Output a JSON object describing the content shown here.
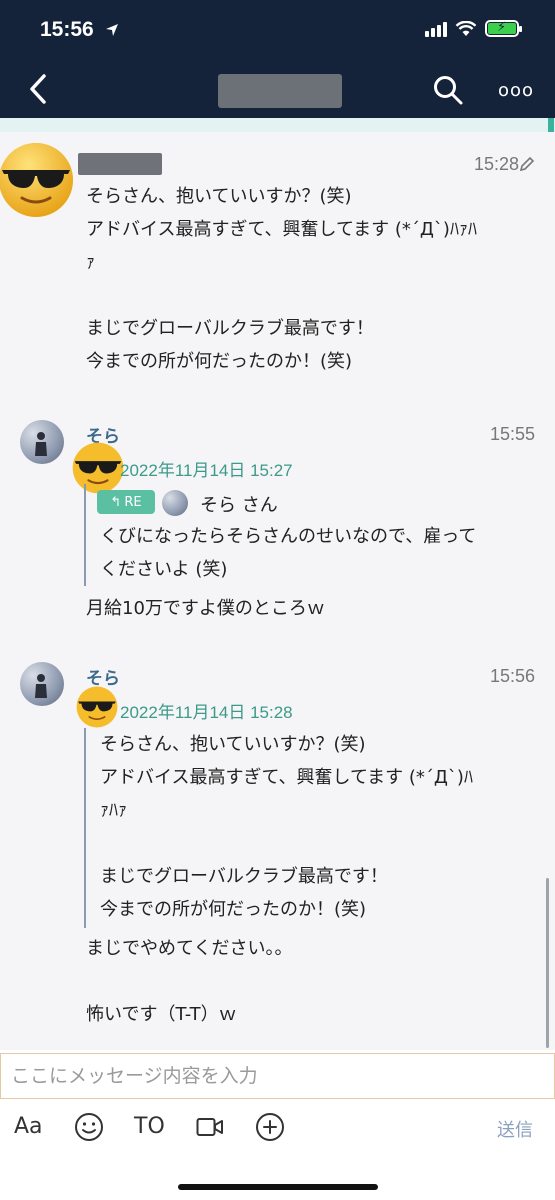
{
  "status_bar": {
    "time": "15:56"
  },
  "header": {
    "back_icon": "chevron-left-icon",
    "search_icon": "search-icon",
    "more_label": "ooo"
  },
  "messages": [
    {
      "time": "15:28",
      "edit_icon": "pencil-icon",
      "body": "そらさん、抱いていいすか？(笑)\nアドバイス最高すぎて、興奮してます (*´Д`)ﾊｧﾊ\nｧ\n\nまじでグローバルクラブ最高です！\n今までの所が何だったのか！(笑)"
    },
    {
      "name": "そら",
      "time": "15:55",
      "quote_date": "2022年11月14日 15:27",
      "re_label": "RE",
      "to_name": "そら さん",
      "quote_text": "くびになったらそらさんのせいなので、雇って\nくださいよ (笑)",
      "body": "月給10万ですよ僕のところｗ"
    },
    {
      "name": "そら",
      "time": "15:56",
      "quote_date": "2022年11月14日 15:28",
      "quote_text": "そらさん、抱いていいすか？(笑)\nアドバイス最高すぎて、興奮してます (*´Д`)ﾊ\nｧﾊｧ\n\nまじでグローバルクラブ最高です！\n今までの所が何だったのか！(笑)",
      "body": "まじでやめてください。。\n\n怖いです（T-T）ｗ"
    }
  ],
  "composer": {
    "placeholder": "ここにメッセージ内容を入力",
    "aa_label": "Aa",
    "to_label": "TO",
    "send_label": "送信"
  }
}
